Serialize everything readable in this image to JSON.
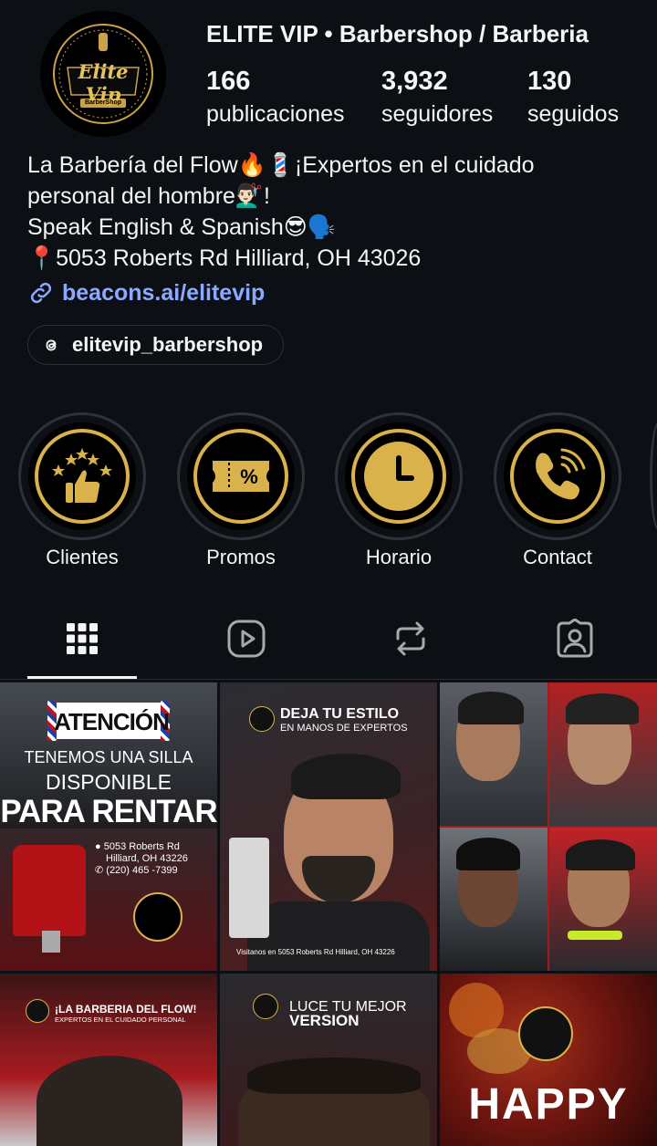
{
  "profile": {
    "username": "ELITE VIP • Barbershop / Barberia",
    "logo_text": "Elite Vip",
    "logo_sub": "BarberShop",
    "stats": [
      {
        "value": "166",
        "label": "publicaciones"
      },
      {
        "value": "3,932",
        "label": "seguidores"
      },
      {
        "value": "130",
        "label": "seguidos"
      }
    ]
  },
  "bio": {
    "line1": "La Barbería del Flow🔥💈¡Expertos en el cuidado",
    "line2": "personal del hombre💇🏻‍♂️!",
    "line3": "Speak English & Spanish😎🗣️",
    "line4": "📍5053 Roberts Rd Hilliard, OH 43026",
    "link": "beacons.ai/elitevip",
    "threads": "elitevip_barbershop"
  },
  "highlights": [
    {
      "label": "Clientes",
      "icon": "thumbs-up-stars-icon"
    },
    {
      "label": "Promos",
      "icon": "ticket-percent-icon"
    },
    {
      "label": "Horario",
      "icon": "clock-icon"
    },
    {
      "label": "Contact",
      "icon": "phone-icon"
    }
  ],
  "tabs": [
    "grid-icon",
    "reels-icon",
    "reposts-icon",
    "tagged-icon"
  ],
  "posts": {
    "p1": {
      "title": "ATENCIÓN",
      "line1": "TENEMOS UNA SILLA",
      "line2": "DISPONIBLE",
      "line3": "PARA RENTAR",
      "addr1": "5053 Roberts Rd",
      "addr2": "Hilliard, OH 43226",
      "phone": "(220) 465 -7399"
    },
    "p2": {
      "title": "DEJA TU ESTILO",
      "sub": "EN MANOS DE EXPERTOS",
      "footer": "Visitanos en 5053 Roberts Rd Hilliard, OH 43226"
    },
    "p4": {
      "title": "¡LA BARBERIA DEL FLOW!",
      "sub": "EXPERTOS EN EL CUIDADO PERSONAL"
    },
    "p5": {
      "title1": "LUCE TU MEJOR",
      "title2": "VERSION"
    },
    "p6": {
      "title": "HAPPY"
    }
  }
}
